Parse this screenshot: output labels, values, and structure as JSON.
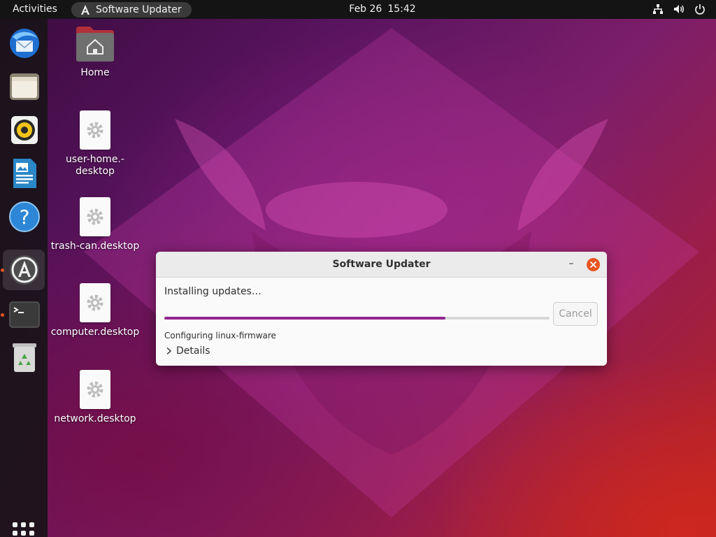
{
  "topbar": {
    "activities_label": "Activities",
    "app_name": "Software Updater",
    "date": "Feb 26",
    "time": "15:42",
    "tray_icons": [
      "network-icon",
      "volume-icon",
      "power-icon"
    ]
  },
  "dock": {
    "items": [
      {
        "name": "thunderbird",
        "icon": "thunderbird-icon"
      },
      {
        "name": "files",
        "icon": "files-icon"
      },
      {
        "name": "rhythmbox",
        "icon": "rhythmbox-icon"
      },
      {
        "name": "libreoffice-writer",
        "icon": "writer-icon"
      },
      {
        "name": "help",
        "icon": "help-icon"
      },
      {
        "name": "software-updater",
        "icon": "software-updater-icon",
        "active": true
      },
      {
        "name": "terminal",
        "icon": "terminal-icon"
      },
      {
        "name": "trash",
        "icon": "trash-icon"
      }
    ],
    "apps_grid_icon": "show-apps-icon"
  },
  "desktop": {
    "icons": [
      {
        "label": "Home",
        "icon": "home-folder-icon"
      },
      {
        "label": "user-home.-\ndesktop",
        "label_line1": "user-home.-",
        "label_line2": "desktop",
        "icon": "settings-file-icon"
      },
      {
        "label": "trash-can.desktop",
        "icon": "settings-file-icon"
      },
      {
        "label": "computer.desktop",
        "icon": "settings-file-icon"
      },
      {
        "label": "network.desktop",
        "icon": "settings-file-icon"
      }
    ]
  },
  "dialog": {
    "title": "Software Updater",
    "minimize_label": "–",
    "status": "Installing updates…",
    "progress_percent": 73,
    "cancel_label": "Cancel",
    "task": "Configuring linux-firmware",
    "details_label": "Details"
  },
  "colors": {
    "accent": "#e95420",
    "progress": "#92278f",
    "topbar": "#141414"
  }
}
